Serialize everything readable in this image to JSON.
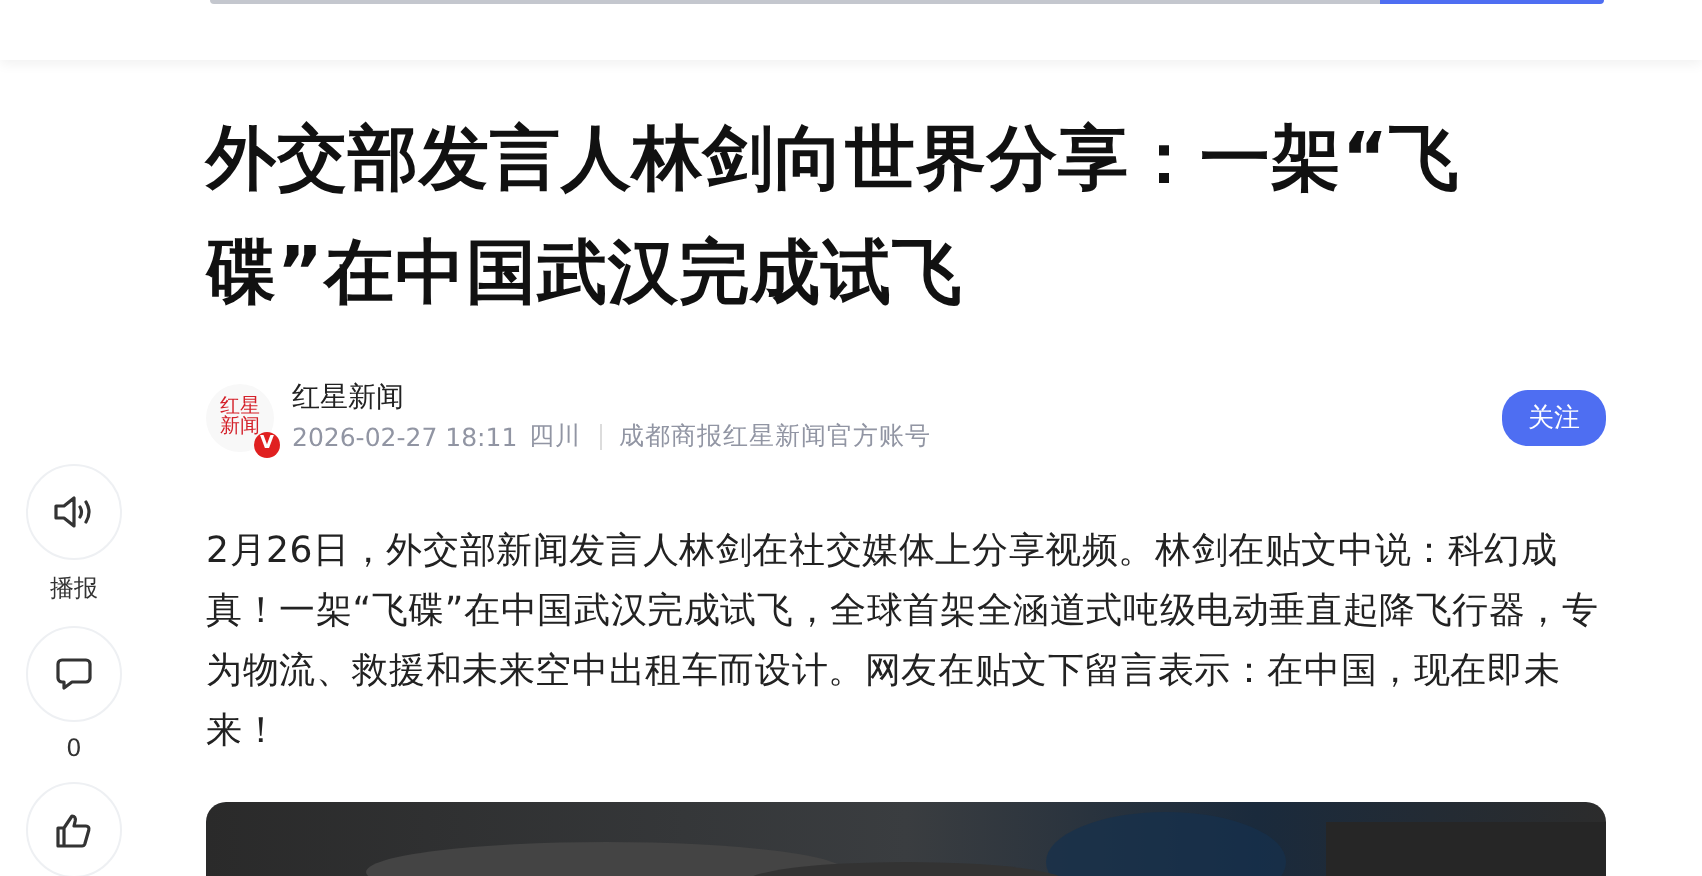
{
  "rail": [
    {
      "kind": "speaker",
      "label": "播报"
    },
    {
      "kind": "comment",
      "label": "0"
    },
    {
      "kind": "like"
    }
  ],
  "article": {
    "title": "外交部发言人林剑向世界分享：一架“飞碟”在中国武汉完成试飞",
    "author": {
      "logo_text": "红星新闻",
      "badge": "V",
      "name": "红星新闻",
      "time": "2026-02-27 18:11",
      "region": "四川",
      "account": "成都商报红星新闻官方账号",
      "follow": "关注"
    },
    "body": "2月26日，外交部新闻发言人林剑在社交媒体上分享视频。林剑在贴文中说：科幻成真！一架“飞碟”在中国武汉完成试飞，全球首架全涵道式吨级电动垂直起降飞行器，专为物流、救援和未来空中出租车而设计。网友在贴文下留言表示：在中国，现在即未来！"
  }
}
